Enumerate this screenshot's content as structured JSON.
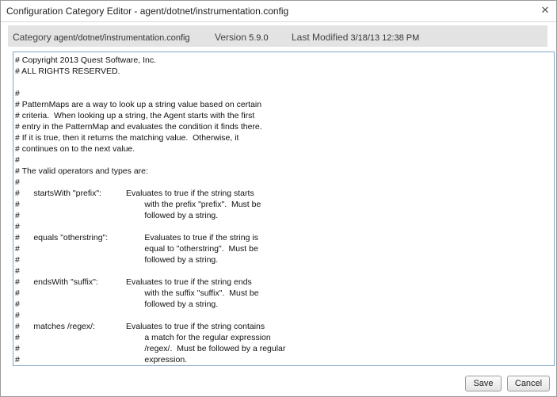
{
  "dialog": {
    "title": "Configuration Category Editor - agent/dotnet/instrumentation.config",
    "close_glyph": "✕"
  },
  "info": {
    "category_label": "Category",
    "category_value": "agent/dotnet/instrumentation.config",
    "version_label": "Version",
    "version_value": "5.9.0",
    "modified_label": "Last Modified",
    "modified_value": "3/18/13 12:38 PM"
  },
  "editor": {
    "content": "# Copyright 2013 Quest Software, Inc.\n# ALL RIGHTS RESERVED.\n\n#\n# PatternMaps are a way to look up a string value based on certain\n# criteria.  When looking up a string, the Agent starts with the first\n# entry in the PatternMap and evaluates the condition it finds there.\n# If it is true, then it returns the matching value.  Otherwise, it\n# continues on to the next value.\n#\n# The valid operators and types are:\n#\n#\tstartsWith \"prefix\":\t\tEvaluates to true if the string starts\n#\t\t\t\t\t\t\twith the prefix \"prefix\".  Must be\n#\t\t\t\t\t\t\tfollowed by a string.\n#\n#\tequals \"otherstring\":\t\tEvaluates to true if the string is\n#\t\t\t\t\t\t\tequal to \"otherstring\".  Must be\n#\t\t\t\t\t\t\tfollowed by a string.\n#\n#\tendsWith \"suffix\":\t\tEvaluates to true if the string ends\n#\t\t\t\t\t\t\twith the suffix \"suffix\".  Must be\n#\t\t\t\t\t\t\tfollowed by a string.\n#\n#\tmatches /regex/:\t\tEvaluates to true if the string contains\n#\t\t\t\t\t\t\ta match for the regular expression\n#\t\t\t\t\t\t\t/regex/.  Must be followed by a regular\n#\t\t\t\t\t\t\texpression.\n#"
  },
  "buttons": {
    "save": "Save",
    "cancel": "Cancel"
  }
}
